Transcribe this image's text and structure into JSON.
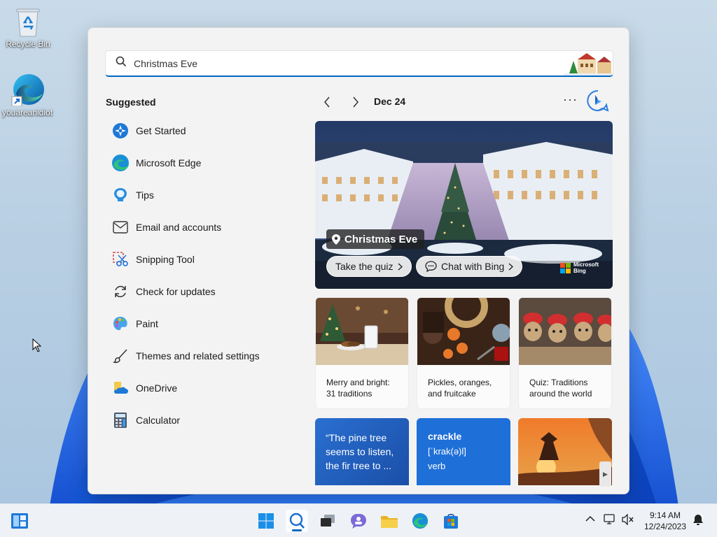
{
  "desktop": {
    "icons": [
      {
        "label": "Recycle Bin",
        "icon": "recycle-bin-icon"
      },
      {
        "label": "youareanidiot",
        "icon": "edge-shortcut-icon"
      }
    ]
  },
  "search": {
    "value": "Christmas Eve",
    "placeholder": "Christmas Eve"
  },
  "suggested": {
    "title": "Suggested",
    "items": [
      {
        "label": "Get Started",
        "icon": "get-started-icon"
      },
      {
        "label": "Microsoft Edge",
        "icon": "edge-icon"
      },
      {
        "label": "Tips",
        "icon": "tips-icon"
      },
      {
        "label": "Email and accounts",
        "icon": "mail-icon"
      },
      {
        "label": "Snipping Tool",
        "icon": "snipping-tool-icon"
      },
      {
        "label": "Check for updates",
        "icon": "refresh-icon"
      },
      {
        "label": "Paint",
        "icon": "paint-icon"
      },
      {
        "label": "Themes and related settings",
        "icon": "brush-icon"
      },
      {
        "label": "OneDrive",
        "icon": "onedrive-icon"
      },
      {
        "label": "Calculator",
        "icon": "calculator-icon"
      }
    ]
  },
  "highlights": {
    "date": "Dec 24",
    "more": "···",
    "hero": {
      "title": "Christmas Eve",
      "quiz_label": "Take the quiz",
      "chat_label": "Chat with Bing",
      "brand_line1": "Microsoft",
      "brand_line2": "Bing"
    },
    "cards": [
      {
        "caption": "Merry and bright: 31 traditions"
      },
      {
        "caption": "Pickles, oranges, and fruitcake"
      },
      {
        "caption": "Quiz: Traditions around the world"
      }
    ],
    "quote_tile": "“The pine tree seems to listen, the fir tree to ...",
    "word_tile": {
      "word": "crackle",
      "ipa": "[ˈkrak(ə)l]",
      "pos": "verb"
    }
  },
  "taskbar": {
    "icons": [
      "widgets-icon",
      "start-icon",
      "search-icon",
      "task-view-icon",
      "chat-icon",
      "file-explorer-icon",
      "edge-icon",
      "store-icon"
    ],
    "time": "9:14 AM",
    "date": "12/24/2023"
  },
  "colors": {
    "accent": "#0067c0",
    "quote_tile": "#1e5fbf",
    "word_tile": "#1f6fd8"
  }
}
